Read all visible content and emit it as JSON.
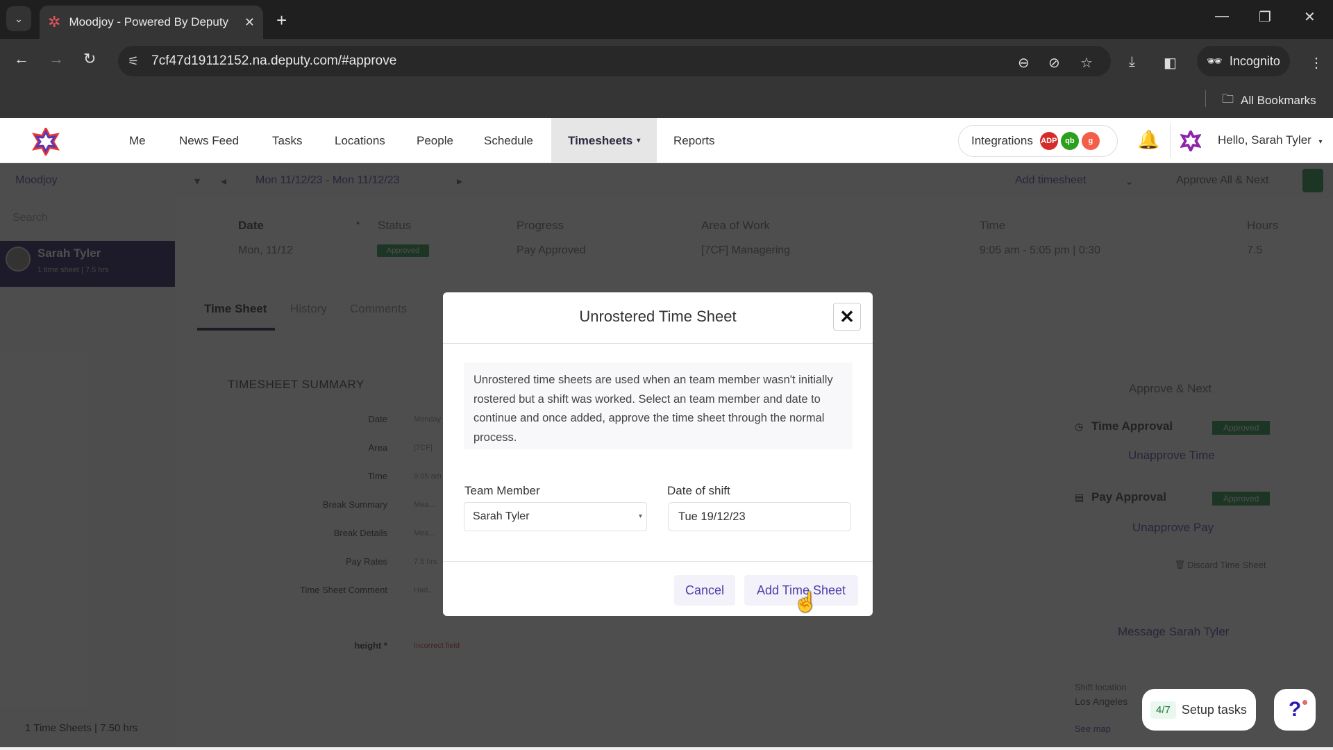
{
  "browser": {
    "tab_title": "Moodjoy - Powered By Deputy",
    "url": "7cf47d19112152.na.deputy.com/#approve",
    "incognito_label": "Incognito",
    "bookmarks_label": "All Bookmarks"
  },
  "nav": {
    "items": [
      "Me",
      "News Feed",
      "Tasks",
      "Locations",
      "People",
      "Schedule",
      "Timesheets",
      "Reports"
    ],
    "active": "Timesheets",
    "integrations_label": "Integrations",
    "integration_badges": [
      {
        "name": "adp",
        "label": "ADP",
        "color": "#d62b2b"
      },
      {
        "name": "quickbooks",
        "label": "qb",
        "color": "#2ca01c"
      },
      {
        "name": "gusto",
        "label": "g",
        "color": "#f45d48"
      }
    ],
    "greeting": "Hello, Sarah Tyler"
  },
  "filter": {
    "location": "Moodjoy",
    "date_range": "Mon 11/12/23 - Mon 11/12/23",
    "add_timesheet": "Add timesheet",
    "approve_all": "Approve All & Next"
  },
  "sidebar": {
    "search_placeholder": "Search",
    "person": {
      "name": "Sarah Tyler",
      "sub": "1 time sheet | 7.5 hrs"
    },
    "footer": "1 Time Sheets | 7.50 hrs"
  },
  "table": {
    "headers": [
      "Date",
      "Status",
      "Progress",
      "Area of Work",
      "Time",
      "Hours"
    ],
    "row": {
      "date": "Mon, 11/12",
      "status": "Approved",
      "progress": "Pay Approved",
      "area": "[7CF] Managering",
      "time": "9:05 am - 5:05 pm | 0:30",
      "hours": "7.5"
    }
  },
  "detail": {
    "tabs": [
      "Time Sheet",
      "History",
      "Comments"
    ],
    "summary_title": "TIMESHEET SUMMARY",
    "rows": [
      {
        "label": "Date",
        "value": "Monday"
      },
      {
        "label": "Area",
        "value": "[7CF]"
      },
      {
        "label": "Time",
        "value": "9:05 am"
      },
      {
        "label": "Break Summary",
        "value": "Mea..."
      },
      {
        "label": "Break Details",
        "value": "Mea..."
      },
      {
        "label": "Pay Rates",
        "value": "7.5 hrs"
      },
      {
        "label": "Time Sheet Comment",
        "value": "Had..."
      },
      {
        "label": "height *",
        "value": "Incorrect field"
      }
    ]
  },
  "right_panel": {
    "approve_next": "Approve & Next",
    "time_approval": "Time Approval",
    "time_status": "Approved",
    "unapprove_time": "Unapprove Time",
    "pay_approval": "Pay Approval",
    "pay_status": "Approved",
    "unapprove_pay": "Unapprove Pay",
    "discard": "Discard Time Sheet",
    "message": "Message Sarah Tyler",
    "shift_location_label": "Shift location",
    "shift_location": "Los Angeles",
    "see_map": "See map"
  },
  "modal": {
    "title": "Unrostered Time Sheet",
    "info": "Unrostered time sheets are used when an team member wasn't initially rostered but a shift was worked. Select an team member and date to continue and once added, approve the time sheet through the normal process.",
    "team_member_label": "Team Member",
    "team_member_value": "Sarah Tyler",
    "date_label": "Date of shift",
    "date_value": "Tue 19/12/23",
    "cancel": "Cancel",
    "add": "Add Time Sheet"
  },
  "floating": {
    "setup_count": "4/7",
    "setup_label": "Setup tasks",
    "help": "?"
  }
}
